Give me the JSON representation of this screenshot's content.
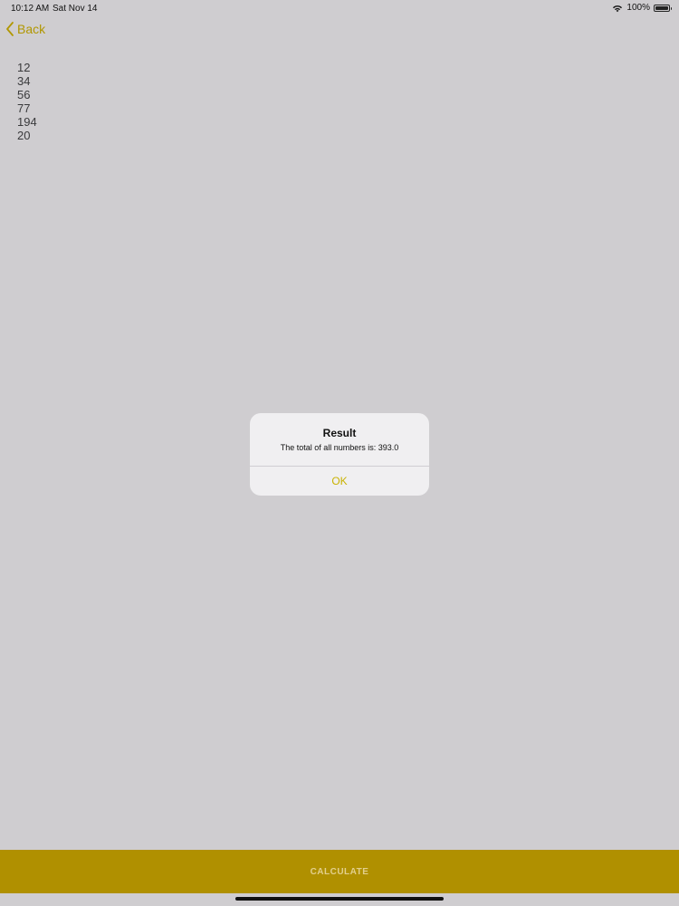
{
  "status_bar": {
    "time": "10:12 AM",
    "date": "Sat Nov 14",
    "battery": "100%",
    "icons": [
      "wifi-icon",
      "battery-icon"
    ]
  },
  "nav": {
    "back_label": "Back",
    "accent_color": "#b19700"
  },
  "numbers": [
    "12",
    "34",
    "56",
    "77",
    "194",
    "20"
  ],
  "alert": {
    "title": "Result",
    "message": "The total of all numbers is: 393.0",
    "ok_label": "OK"
  },
  "footer": {
    "calculate_label": "CALCULATE",
    "button_color": "#b09000"
  }
}
